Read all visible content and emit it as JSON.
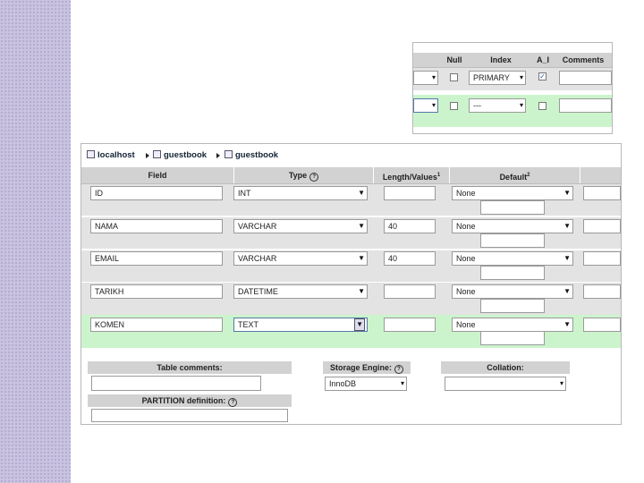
{
  "top_panel": {
    "headers": [
      "Null",
      "Index",
      "A_I",
      "Comments"
    ],
    "rows": [
      {
        "null_checked": false,
        "index": "PRIMARY",
        "ai_checked": true,
        "comments": ""
      },
      {
        "null_checked": false,
        "index": "---",
        "ai_checked": false,
        "comments": ""
      }
    ],
    "arrow_glyph": "▾"
  },
  "breadcrumb": {
    "server": "localhost",
    "database": "guestbook",
    "table": "guestbook"
  },
  "main": {
    "headers": {
      "field": "Field",
      "type": "Type",
      "length": "Length/Values",
      "length_sup": "1",
      "default": "Default",
      "default_sup": "2"
    },
    "help_glyph": "?",
    "rows": [
      {
        "field": "ID",
        "type": "INT",
        "length": "",
        "default": "None"
      },
      {
        "field": "NAMA",
        "type": "VARCHAR",
        "length": "40",
        "default": "None"
      },
      {
        "field": "EMAIL",
        "type": "VARCHAR",
        "length": "40",
        "default": "None"
      },
      {
        "field": "TARIKH",
        "type": "DATETIME",
        "length": "",
        "default": "None"
      },
      {
        "field": "KOMEN",
        "type": "TEXT",
        "length": "",
        "default": "None"
      }
    ]
  },
  "footer": {
    "table_comments_label": "Table comments:",
    "storage_engine_label": "Storage Engine:",
    "storage_engine_value": "InnoDB",
    "collation_label": "Collation:",
    "partition_label": "PARTITION definition:"
  },
  "colors": {
    "sidebar": "#c9c3df",
    "header_grey": "#d2d2d2",
    "row_grey": "#e3e3e3",
    "row_green": "#ccf4cc"
  }
}
